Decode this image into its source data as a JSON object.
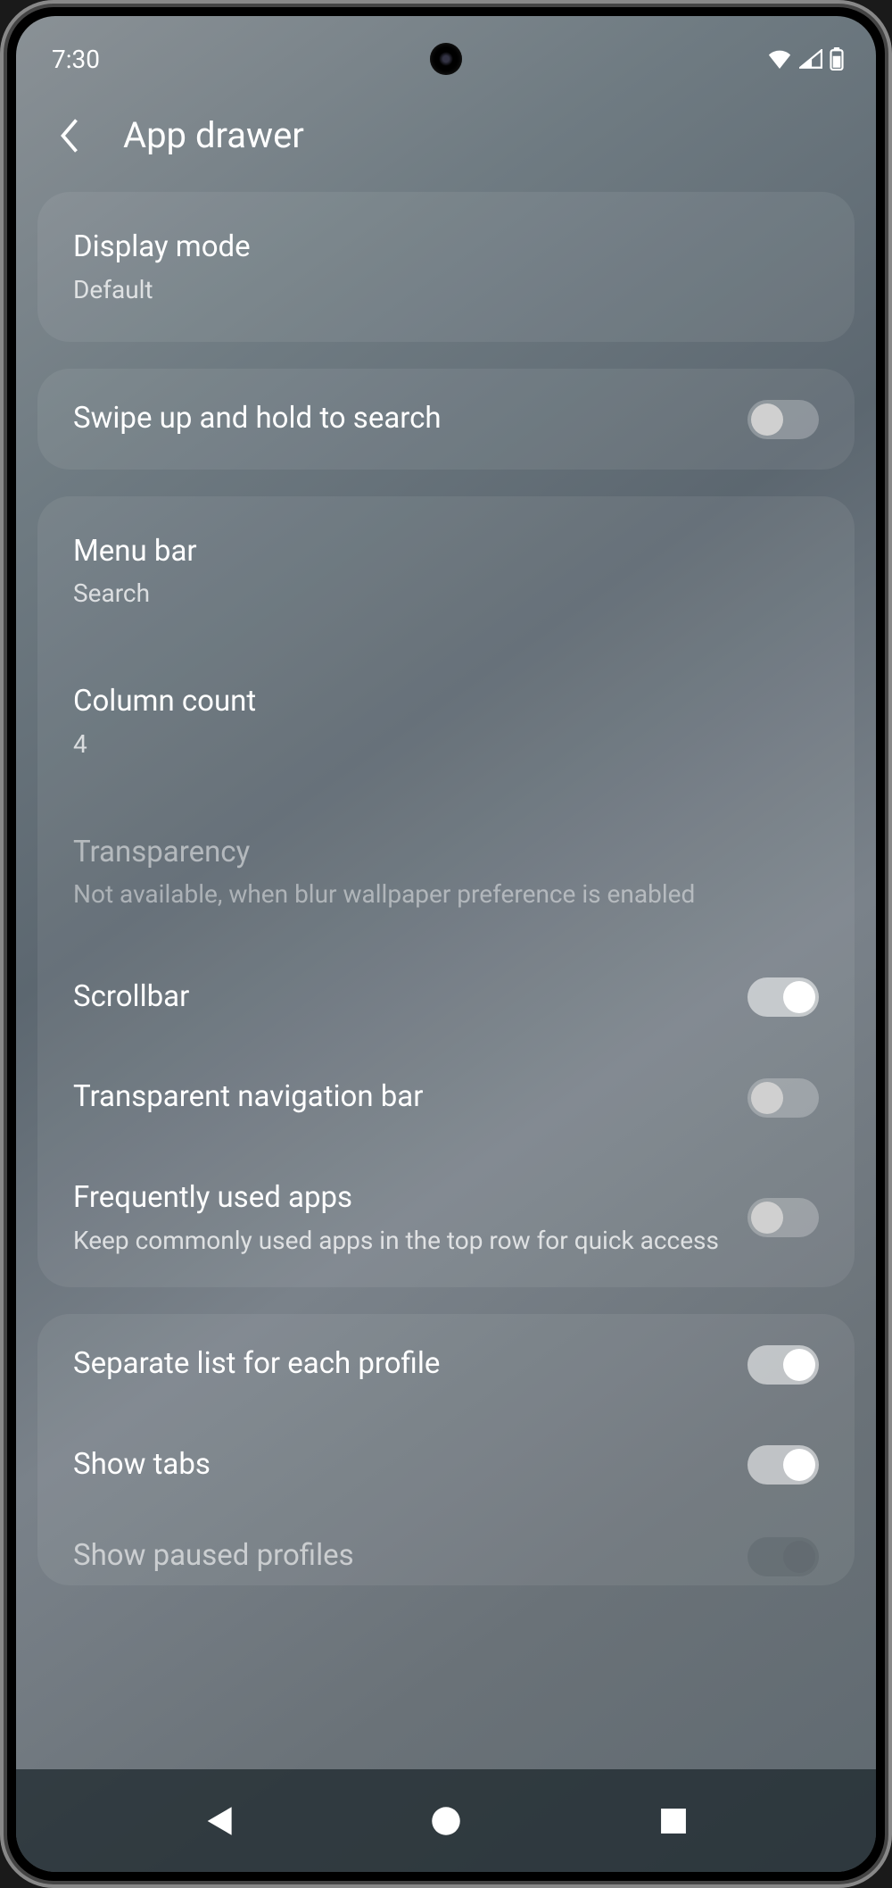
{
  "statusbar": {
    "time": "7:30"
  },
  "header": {
    "title": "App drawer"
  },
  "settings": {
    "display_mode": {
      "title": "Display mode",
      "value": "Default"
    },
    "swipe_search": {
      "title": "Swipe up and hold to search",
      "on": false
    },
    "menu_bar": {
      "title": "Menu bar",
      "value": "Search"
    },
    "column_count": {
      "title": "Column count",
      "value": "4"
    },
    "transparency": {
      "title": "Transparency",
      "sub": "Not available, when blur wallpaper preference is enabled",
      "disabled": true
    },
    "scrollbar": {
      "title": "Scrollbar",
      "on": true
    },
    "transparent_nav": {
      "title": "Transparent navigation bar",
      "on": false
    },
    "freq_apps": {
      "title": "Frequently used apps",
      "sub": "Keep commonly used apps in the top row for quick access",
      "on": false
    },
    "separate_list": {
      "title": "Separate list for each profile",
      "on": true
    },
    "show_tabs": {
      "title": "Show tabs",
      "on": true
    },
    "show_paused": {
      "title": "Show paused profiles",
      "on": true,
      "disabled": true
    }
  }
}
